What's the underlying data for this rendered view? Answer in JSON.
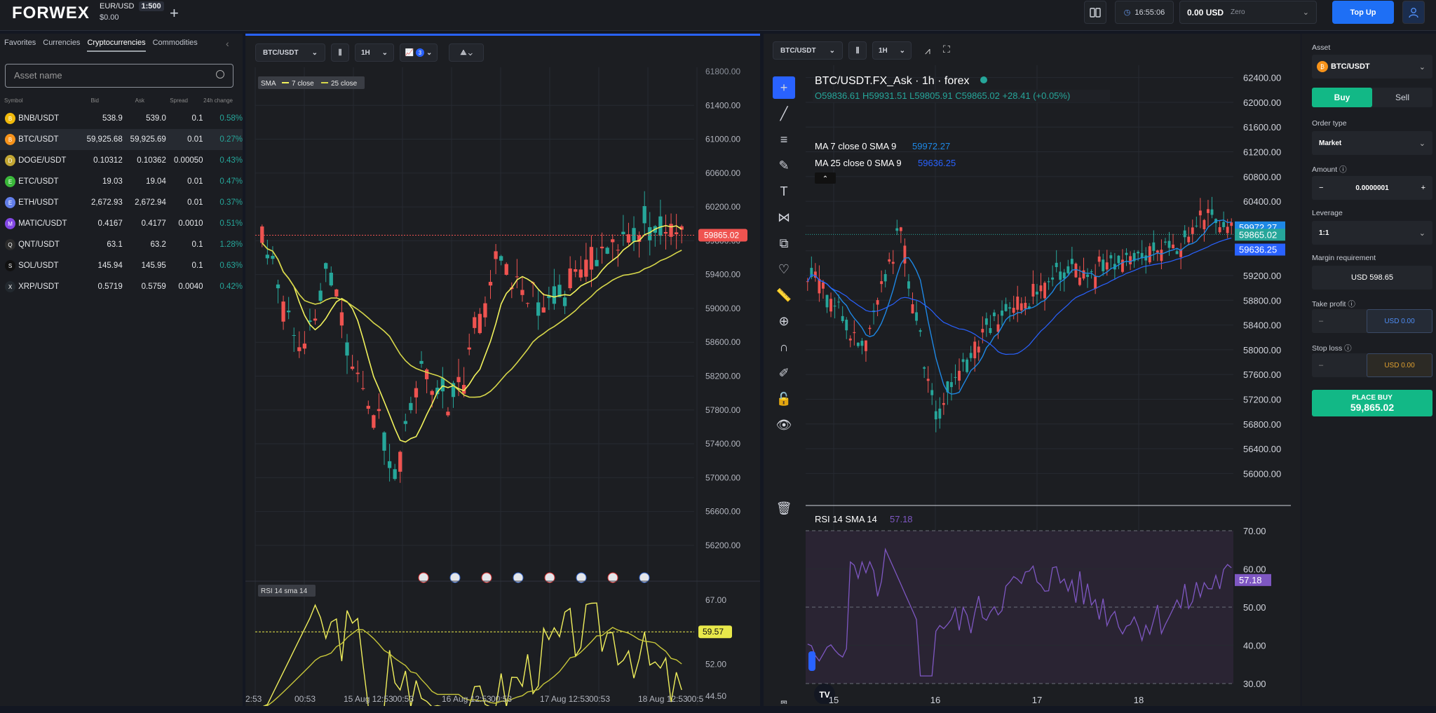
{
  "topbar": {
    "logo": "FORWEX",
    "account_pair": "EUR/USD",
    "leverage": "1:500",
    "balance": "$0.00",
    "time": "16:55:06",
    "equity": "0.00 USD",
    "equity_tag": "Zero",
    "topup_label": "Top Up"
  },
  "left_panel": {
    "tabs": [
      "Favorites",
      "Currencies",
      "Cryptocurrencies",
      "Commodities"
    ],
    "active_tab": "Cryptocurrencies",
    "search_placeholder": "Asset name",
    "headers": {
      "symbol": "Symbol",
      "bid": "Bid",
      "ask": "Ask",
      "spread": "Spread",
      "change": "24h change"
    },
    "rows": [
      {
        "symbol": "BNB/USDT",
        "bid": "538.9",
        "ask": "539.0",
        "spread": "0.1",
        "change": "0.58%",
        "color": "#f0b90b"
      },
      {
        "symbol": "BTC/USDT",
        "bid": "59,925.68",
        "ask": "59,925.69",
        "spread": "0.01",
        "change": "0.27%",
        "color": "#f7931a"
      },
      {
        "symbol": "DOGE/USDT",
        "bid": "0.10312",
        "ask": "0.10362",
        "spread": "0.00050",
        "change": "0.43%",
        "color": "#c2a633"
      },
      {
        "symbol": "ETC/USDT",
        "bid": "19.03",
        "ask": "19.04",
        "spread": "0.01",
        "change": "0.47%",
        "color": "#3ab83a"
      },
      {
        "symbol": "ETH/USDT",
        "bid": "2,672.93",
        "ask": "2,672.94",
        "spread": "0.01",
        "change": "0.37%",
        "color": "#627eea"
      },
      {
        "symbol": "MATIC/USDT",
        "bid": "0.4167",
        "ask": "0.4177",
        "spread": "0.0010",
        "change": "0.51%",
        "color": "#8247e5"
      },
      {
        "symbol": "QNT/USDT",
        "bid": "63.1",
        "ask": "63.2",
        "spread": "0.1",
        "change": "1.28%",
        "color": "#2c2c2c"
      },
      {
        "symbol": "SOL/USDT",
        "bid": "145.94",
        "ask": "145.95",
        "spread": "0.1",
        "change": "0.63%",
        "color": "#111111"
      },
      {
        "symbol": "XRP/USDT",
        "bid": "0.5719",
        "ask": "0.5759",
        "spread": "0.0040",
        "change": "0.42%",
        "color": "#23292f"
      }
    ]
  },
  "chart1": {
    "toolbar": {
      "pair": "BTC/USDT",
      "interval": "1H",
      "indicator_count": "3"
    },
    "legend": {
      "name": "SMA",
      "s1": "7 close",
      "s2": "25 close"
    },
    "price_axis": [
      "61400.00",
      "61000.00",
      "60600.00",
      "60200.00",
      "59800.00",
      "59400.00",
      "59000.00",
      "58600.00",
      "58200.00",
      "57800.00",
      "57400.00",
      "57000.00",
      "56600.00",
      "56200.00"
    ],
    "price_axis_top": "61800.00",
    "last_price": "59865.02",
    "rsi_label": "RSI 14 sma 14",
    "rsi_axis": [
      "67.00",
      "52.00",
      "44.50"
    ],
    "rsi_value": "59.57",
    "time_axis": [
      "2:53",
      "00:53",
      "15 Aug 12:53",
      "00:53",
      "16 Aug 12:53",
      "00:53",
      "17 Aug 12:53",
      "00:53",
      "18 Aug 12:53",
      "00:5"
    ]
  },
  "chart2": {
    "toolbar": {
      "pair": "BTC/USDT",
      "interval": "1H"
    },
    "title": "BTC/USDT.FX_Ask · 1h · forex",
    "ohlc": {
      "o": "59836.61",
      "h": "59931.51",
      "l": "59805.91",
      "c": "59865.02",
      "chg": "+28.41 (+0.05%)"
    },
    "ma7": {
      "label": "MA 7 close 0 SMA 9",
      "value": "59972.27"
    },
    "ma25": {
      "label": "MA 25 close 0 SMA 9",
      "value": "59636.25"
    },
    "price_axis": [
      "62400.00",
      "62000.00",
      "61600.00",
      "61200.00",
      "60800.00",
      "60400.00",
      "60000.00",
      "59600.00",
      "59200.00",
      "58800.00",
      "58400.00",
      "58000.00",
      "57600.00",
      "57200.00",
      "56800.00",
      "56400.00",
      "56000.00"
    ],
    "tags": [
      "59972.27",
      "59865.02",
      "59636.25"
    ],
    "rsi": {
      "label": "RSI 14 SMA 14",
      "value": "57.18",
      "axis": [
        "70.00",
        "60.00",
        "50.00",
        "40.00",
        "30.00"
      ]
    },
    "time_axis": [
      "15",
      "16",
      "17",
      "18"
    ]
  },
  "order_panel": {
    "asset_label": "Asset",
    "asset": "BTC/USDT",
    "buy": "Buy",
    "sell": "Sell",
    "order_type_label": "Order type",
    "order_type": "Market",
    "amount_label": "Amount",
    "amount": "0.0000001",
    "leverage_label": "Leverage",
    "leverage": "1:1",
    "margin_label": "Margin requirement",
    "margin": "USD 598.65",
    "tp_label": "Take profit",
    "tp_value": "USD 0.00",
    "sl_label": "Stop loss",
    "sl_value": "USD 0.00",
    "place_label": "PLACE BUY",
    "place_price": "59,865.02"
  },
  "colors": {
    "up": "#26a69a",
    "down": "#ef5350",
    "accent": "#1e6ff5",
    "sma_fast": "#f1f25c",
    "sma_slow": "#d6d64a",
    "rsi": "#7e57c2",
    "ma25": "#2962ff"
  }
}
